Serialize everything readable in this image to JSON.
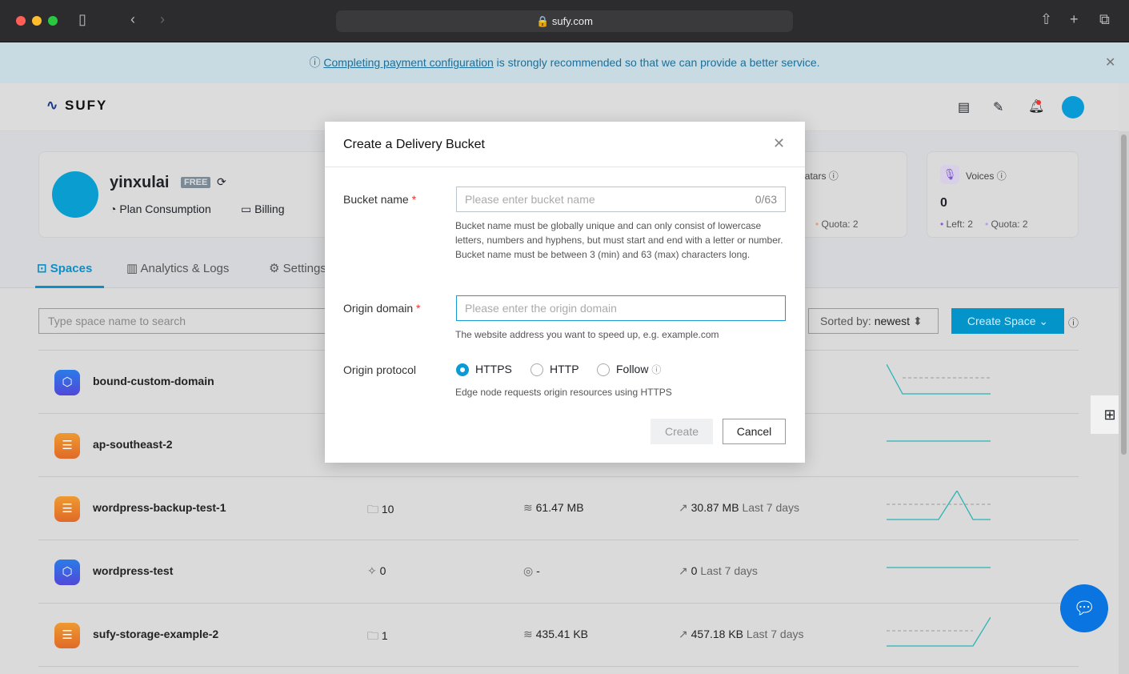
{
  "browser": {
    "url": "sufy.com"
  },
  "banner": {
    "link": "Completing payment configuration",
    "text": " is strongly recommended so that we can provide a better service."
  },
  "header": {
    "logo": "SUFY"
  },
  "profile": {
    "username": "yinxulai",
    "plan_badge": "FREE",
    "links": [
      "Plan Consumption",
      "Billing"
    ]
  },
  "stats": [
    {
      "title": "Avatars",
      "quota": "Quota: 2"
    },
    {
      "title": "Voices",
      "value": "0",
      "left": "Left: 2",
      "quota": "Quota: 2"
    }
  ],
  "tabs": [
    {
      "label": "Spaces",
      "active": true
    },
    {
      "label": "Analytics & Logs"
    },
    {
      "label": "Settings"
    }
  ],
  "toolbar": {
    "search_placeholder": "Type space name to search",
    "sort_label": "Sorted by: ",
    "sort_value": "newest",
    "create_label": "Create Space"
  },
  "rows": [
    {
      "name": "bound-custom-domain",
      "type": "domain"
    },
    {
      "name": "ap-southeast-2",
      "type": "storage"
    },
    {
      "name": "wordpress-backup-test-1",
      "type": "storage",
      "count": "10",
      "size": "61.47 MB",
      "traffic": "30.87 MB",
      "period": "Last 7 days"
    },
    {
      "name": "wordpress-test",
      "type": "domain",
      "count": "0",
      "size": "-",
      "traffic": "0",
      "period": "Last 7 days"
    },
    {
      "name": "sufy-storage-example-2",
      "type": "storage",
      "count": "1",
      "size": "435.41 KB",
      "traffic": "457.18 KB",
      "period": "Last 7 days"
    }
  ],
  "modal": {
    "title": "Create a Delivery Bucket",
    "bucket_label": "Bucket name",
    "bucket_placeholder": "Please enter bucket name",
    "bucket_count": "0/63",
    "bucket_help": "Bucket name must be globally unique and can only consist of lowercase letters, numbers and hyphens, but must start and end with a letter or number. Bucket name must be between 3 (min) and 63 (max) characters long.",
    "origin_label": "Origin domain",
    "origin_placeholder": "Please enter the origin domain",
    "origin_help": "The website address you want to speed up, e.g. example.com",
    "protocol_label": "Origin protocol",
    "protocols": [
      "HTTPS",
      "HTTP",
      "Follow"
    ],
    "protocol_selected": "HTTPS",
    "protocol_help": "Edge node requests origin resources using HTTPS",
    "create": "Create",
    "cancel": "Cancel"
  },
  "colors": {
    "accent": "#0a9ad6",
    "required": "#e33"
  }
}
